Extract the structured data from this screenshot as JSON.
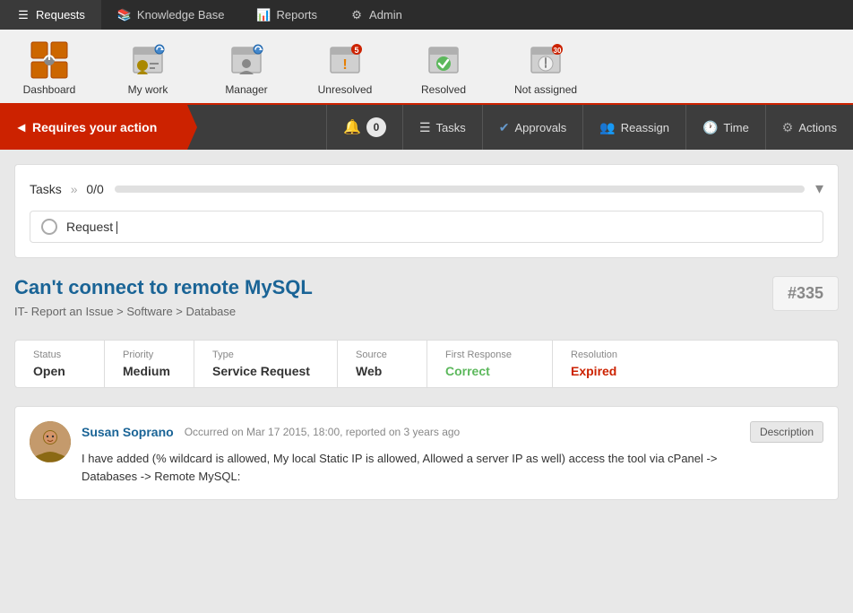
{
  "topNav": {
    "items": [
      {
        "id": "requests",
        "label": "Requests",
        "icon": "☰",
        "active": true
      },
      {
        "id": "knowledge-base",
        "label": "Knowledge Base",
        "icon": "📚",
        "active": false
      },
      {
        "id": "reports",
        "label": "Reports",
        "icon": "📊",
        "active": false
      },
      {
        "id": "admin",
        "label": "Admin",
        "icon": "⚙",
        "active": false
      }
    ]
  },
  "iconNav": {
    "items": [
      {
        "id": "dashboard",
        "label": "Dashboard",
        "icon": "📊",
        "badge": null
      },
      {
        "id": "my-work",
        "label": "My work",
        "icon": "📋",
        "badge": null
      },
      {
        "id": "manager",
        "label": "Manager",
        "icon": "👤",
        "badge": null
      },
      {
        "id": "unresolved",
        "label": "Unresolved",
        "icon": "⚠",
        "badge": "5"
      },
      {
        "id": "resolved",
        "label": "Resolved",
        "icon": "✅",
        "badge": null
      },
      {
        "id": "not-assigned",
        "label": "Not assigned",
        "icon": "🕐",
        "badge": "30"
      }
    ]
  },
  "actionBar": {
    "requiresAction": "Requires your action",
    "items": [
      {
        "id": "notifications",
        "label": "0",
        "icon": "🔔",
        "showCount": true
      },
      {
        "id": "tasks",
        "label": "Tasks",
        "icon": "☰",
        "showCount": false
      },
      {
        "id": "approvals",
        "label": "Approvals",
        "icon": "✔",
        "showCount": false
      },
      {
        "id": "reassign",
        "label": "Reassign",
        "icon": "👥",
        "showCount": false
      },
      {
        "id": "time",
        "label": "Time",
        "icon": "🕐",
        "showCount": false
      },
      {
        "id": "actions",
        "label": "Actions",
        "icon": "⚙",
        "showCount": false
      }
    ]
  },
  "tasksBox": {
    "title": "Tasks",
    "separator": "»",
    "count": "0/0",
    "inputPlaceholder": "Request |"
  },
  "ticket": {
    "title": "Can't connect to remote MySQL",
    "id": "#335",
    "breadcrumb": "IT- Report an Issue > Software > Database",
    "status": {
      "label": "Status",
      "value": "Open"
    },
    "priority": {
      "label": "Priority",
      "value": "Medium"
    },
    "type": {
      "label": "Type",
      "value": "Service Request"
    },
    "source": {
      "label": "Source",
      "value": "Web"
    },
    "firstResponse": {
      "label": "First Response",
      "value": "Correct",
      "color": "green"
    },
    "resolution": {
      "label": "Resolution",
      "value": "Expired",
      "color": "red"
    }
  },
  "comment": {
    "author": "Susan Soprano",
    "meta": "Occurred on Mar 17 2015, 18:00, reported on 3 years ago",
    "descriptionLabel": "Description",
    "text": "I have added (% wildcard is allowed, My local Static IP is allowed, Allowed a server IP as well) access the tool via cPanel ->\nDatabases -> Remote MySQL:"
  }
}
